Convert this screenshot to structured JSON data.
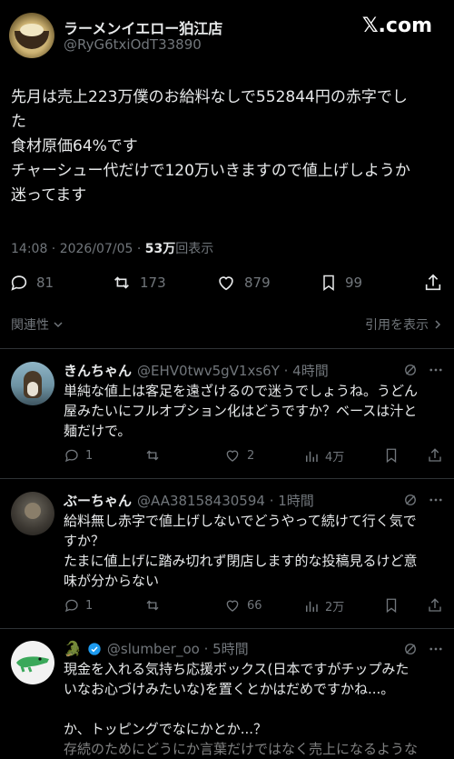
{
  "post": {
    "author_name": "ラーメンイエロー狛江店",
    "author_handle": "@RyG6txiOdT33890",
    "watermark": "𝕏.com",
    "text_lines": [
      "先月は売上223万僕のお給料なしで552844円の赤字でし",
      "た",
      "食材原価64%です",
      "チャーシュー代だけで120万いきますので値上げしようか",
      "迷ってます"
    ],
    "time": "14:08 · 2026/07/05 · ",
    "views_count": "53万",
    "views_label": "回表示",
    "stats": {
      "replies": "81",
      "reposts": "173",
      "likes": "879",
      "bookmarks": "99"
    },
    "related_label": "関連性",
    "quotes_label": "引用を表示"
  },
  "replies": [
    {
      "name": "きんちゃん",
      "handle": "@EHV0twv5gV1xs6Y · 4時間",
      "lines": [
        "単純な値上は客足を遠ざけるので迷うでしょうね。うどん",
        "屋みたいにフルオプション化はどうですか？ベースは汁と",
        "麺だけで。"
      ],
      "stats": {
        "replies": "1",
        "reposts": "",
        "likes": "2",
        "views": "4万"
      }
    },
    {
      "name": "ぶーちゃん",
      "handle": "@AA38158430594 · 1時間",
      "lines": [
        "給料無し赤字で値上げしないでどうやって続けて行く気で",
        "すか？",
        "たまに値上げに踏み切れず閉店します的な投稿見るけど意",
        "味が分からない"
      ],
      "stats": {
        "replies": "1",
        "reposts": "",
        "likes": "66",
        "views": "2万"
      }
    },
    {
      "name": "🐊",
      "handle": "@slumber_oo · 5時間",
      "lines": [
        "現金を入れる気持ち応援ボックス(日本ですがチップみた",
        "いなお心づけみたいな)を置くとかはだめですかね...。",
        "",
        "か、トッピングでなにかとか...？",
        "存続のためにどうにか言葉だけではなく売上になるような"
      ]
    }
  ],
  "colors": {
    "background": "#000000",
    "text": "#e7e9ea",
    "muted": "#71767b",
    "divider": "#2f3336",
    "verified": "#1d9bf0"
  }
}
